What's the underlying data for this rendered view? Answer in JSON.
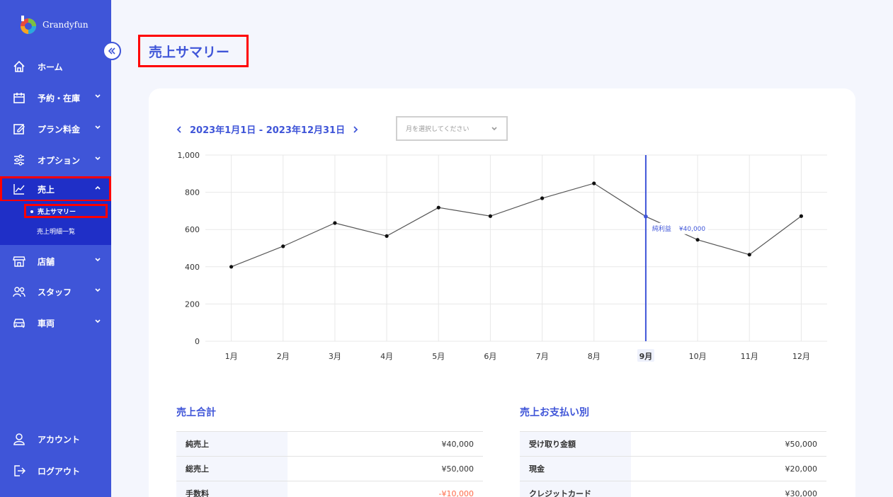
{
  "app": {
    "brand": "Grandyfun"
  },
  "sidebar": {
    "items": [
      {
        "label": "ホーム",
        "icon": "home-icon"
      },
      {
        "label": "予約・在庫",
        "icon": "calendar-icon"
      },
      {
        "label": "プラン料金",
        "icon": "edit-icon"
      },
      {
        "label": "オプション",
        "icon": "sliders-icon"
      },
      {
        "label": "売上",
        "icon": "chart-line-icon"
      },
      {
        "label": "店舗",
        "icon": "store-icon"
      },
      {
        "label": "スタッフ",
        "icon": "users-icon"
      },
      {
        "label": "車両",
        "icon": "car-icon"
      }
    ],
    "sub_items": [
      {
        "label": "売上サマリー"
      },
      {
        "label": "売上明細一覧"
      }
    ],
    "bottom": [
      {
        "label": "アカウント",
        "icon": "user-icon"
      },
      {
        "label": "ログアウト",
        "icon": "logout-icon"
      }
    ]
  },
  "page": {
    "title": "売上サマリー",
    "date_range": "2023年1月1日 - 2023年12月31日",
    "month_select_placeholder": "月を選択してください"
  },
  "chart_data": {
    "type": "line",
    "categories": [
      "1月",
      "2月",
      "3月",
      "4月",
      "5月",
      "6月",
      "7月",
      "8月",
      "9月",
      "10月",
      "11月",
      "12月"
    ],
    "values": [
      400,
      510,
      635,
      565,
      718,
      672,
      768,
      848,
      670,
      545,
      465,
      672
    ],
    "ylim": [
      0,
      1000
    ],
    "yticks": [
      "0",
      "200",
      "400",
      "600",
      "800",
      "1,000"
    ],
    "highlight_index": 8,
    "tooltip": {
      "label": "純利益",
      "value": "¥40,000"
    },
    "grid": true,
    "colors": {
      "line": "#555555",
      "highlight": "#3f55d8"
    }
  },
  "sales_total": {
    "title": "売上合計",
    "rows": [
      {
        "label": "純売上",
        "value": "¥40,000"
      },
      {
        "label": "総売上",
        "value": "¥50,000"
      },
      {
        "label": "手数料",
        "value": "-¥10,000"
      }
    ]
  },
  "payment_breakdown": {
    "title": "売上お支払い別",
    "rows": [
      {
        "label": "受け取り金額",
        "value": "¥50,000"
      },
      {
        "label": "現金",
        "value": "¥20,000"
      },
      {
        "label": "クレジットカード",
        "value": "¥30,000"
      }
    ]
  },
  "colors": {
    "sidebar": "#3f55d8",
    "sidebar_active": "#1f2fc7",
    "accent": "#3f55d8",
    "negative": "#ff6b4a",
    "annotation": "#ff0000"
  }
}
